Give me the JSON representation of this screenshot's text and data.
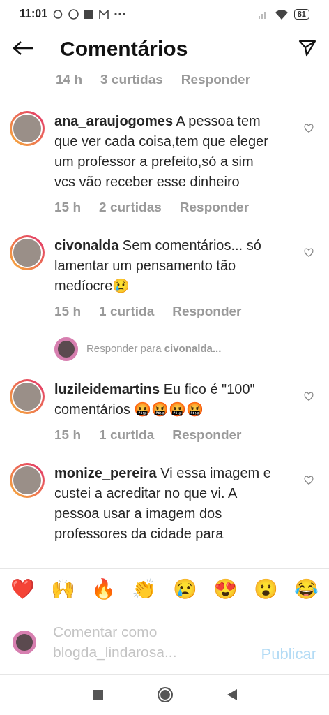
{
  "status_bar": {
    "time": "11:01",
    "battery": "81"
  },
  "header": {
    "title": "Comentários"
  },
  "comments": [
    {
      "kind": "meta",
      "time": "14 h",
      "likes": "3 curtidas",
      "reply": "Responder"
    },
    {
      "kind": "comment",
      "username": "ana_araujogomes",
      "text": "A pessoa tem que ver cada coisa,tem que eleger um professor a prefeito,só a sim vcs vão receber esse dinheiro",
      "time": "15 h",
      "likes": "2 curtidas",
      "reply": "Responder"
    },
    {
      "kind": "comment",
      "username": "civonalda",
      "text": "Sem comentários... só lamentar um pensamento tão medíocre😢",
      "time": "15 h",
      "likes": "1 curtida",
      "reply": "Responder"
    },
    {
      "kind": "reply_prompt",
      "prefix": "Responder para",
      "username": "civonalda..."
    },
    {
      "kind": "comment",
      "username": "luzileidemartins",
      "text": "Eu fico é \"100\" comentários 🤬🤬🤬🤬",
      "time": "15 h",
      "likes": "1 curtida",
      "reply": "Responder"
    },
    {
      "kind": "comment",
      "username": "monize_pereira",
      "text": "Vi essa imagem e custei a acreditar no que vi. A pessoa usar a imagem dos professores da cidade para"
    }
  ],
  "reactions": [
    "❤️",
    "🙌",
    "🔥",
    "👏",
    "😢",
    "😍",
    "😮",
    "😂"
  ],
  "composer": {
    "placeholder": "Comentar como blogda_lindarosa...",
    "submit": "Publicar"
  }
}
